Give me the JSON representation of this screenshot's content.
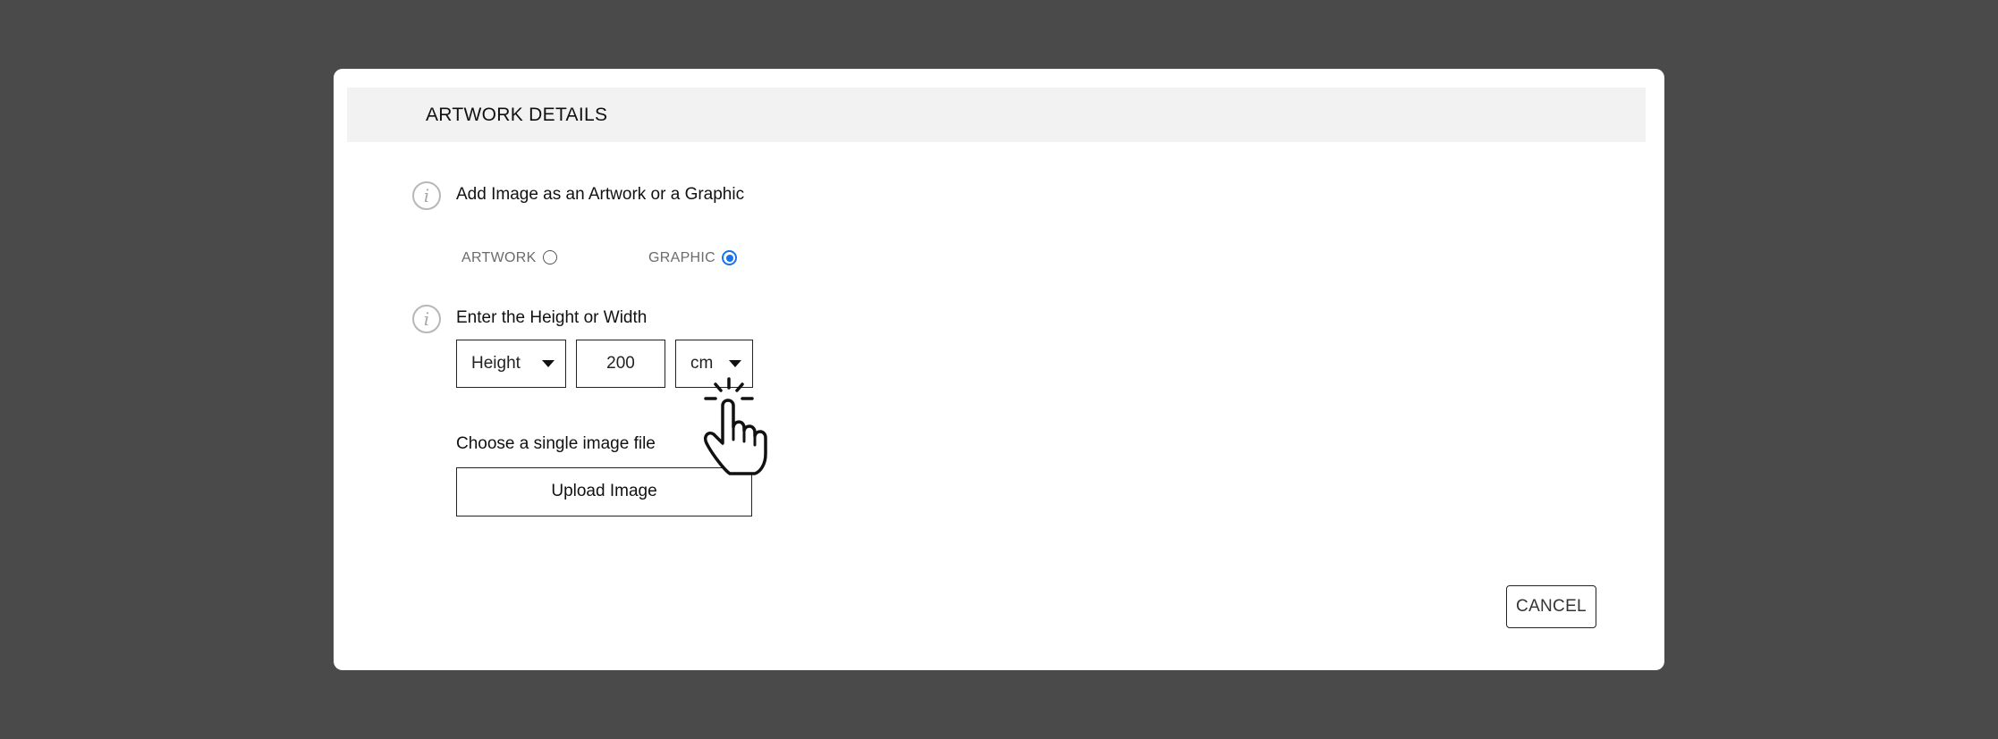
{
  "dialog": {
    "title": "ARTWORK DETAILS",
    "image_type": {
      "label": "Add Image as an Artwork or a Graphic",
      "options": [
        {
          "label": "ARTWORK",
          "selected": false
        },
        {
          "label": "GRAPHIC",
          "selected": true
        }
      ]
    },
    "dimensions": {
      "label": "Enter the Height or Width",
      "dimension_select": "Height",
      "value": "200",
      "unit_select": "cm"
    },
    "file": {
      "label": "Choose a single image file",
      "upload_label": "Upload Image"
    },
    "cancel_label": "CANCEL"
  },
  "icons": {
    "info": "i",
    "cursor": "pointing-hand-click-icon"
  },
  "colors": {
    "backdrop": "#4a4a4a",
    "header_bg": "#f2f2f2",
    "radio_selected": "#1a73e8"
  }
}
